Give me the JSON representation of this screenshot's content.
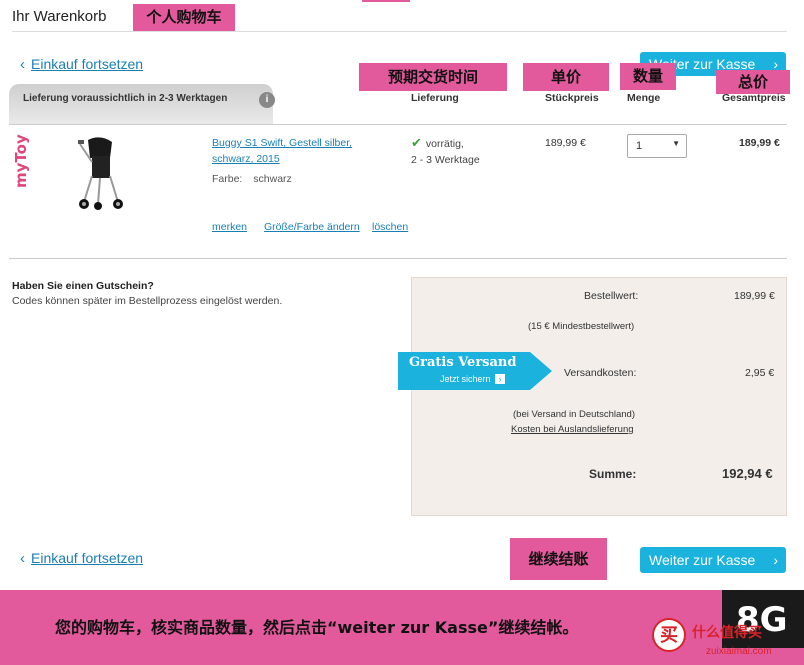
{
  "header": {
    "title": "Ihr Warenkorb",
    "title_tag": "个人购物车"
  },
  "continue_shopping": "Einkauf fortsetzen",
  "checkout_button": "Weiter zur Kasse",
  "delivery_tab": {
    "text": "Lieferung voraussichtlich in 2-3 Werktagen",
    "info_icon": "i"
  },
  "columns": {
    "delivery": "Lieferung",
    "unit_price": "Stückpreis",
    "quantity": "Menge",
    "total_price": "Gesamtpreis"
  },
  "column_tags": {
    "delivery": "预期交货时间",
    "unit_price": "单价",
    "quantity": "数量",
    "total_price": "总价"
  },
  "item": {
    "brand_logo": "myToys",
    "name_line1": "Buggy S1 Swift, Gestell silber,",
    "name_line2": "schwarz, 2015",
    "color_label": "Farbe:",
    "color_value": "schwarz",
    "availability": "vorrätig,",
    "delivery_time": "2 - 3 Werktage",
    "unit_price": "189,99 €",
    "quantity": "1",
    "total_price": "189,99 €",
    "actions": [
      "merken",
      "Größe/Farbe ändern",
      "löschen"
    ]
  },
  "voucher": {
    "title": "Haben Sie einen Gutschein?",
    "text": "Codes können später im Bestellprozess eingelöst werden."
  },
  "summary": {
    "order_value_label": "Bestellwert:",
    "order_value": "189,99 €",
    "minimum_note": "(15 € Mindestbestellwert)",
    "shipping_label": "Versandkosten:",
    "shipping_value": "2,95 €",
    "shipping_note": "(bei Versand in Deutschland)",
    "abroad_link": "Kosten bei Auslandslieferung",
    "sum_label": "Summe:",
    "sum_value": "192,94 €"
  },
  "free_shipping_badge": {
    "title": "Gratis Versand",
    "subtitle": "Jetzt sichern"
  },
  "checkout_tag": "继续结账",
  "bottom_banner": {
    "text": "您的购物车，核实商品数量，然后点击“weiter zur Kasse”继续结帐。",
    "logo_text": "8G",
    "watermark": "什么值得买",
    "watermark_url": "zuixiaimai.com",
    "watermark_char": "买"
  },
  "colors": {
    "accent_pink": "#e35a9c",
    "teal": "#1bb3de",
    "summary_bg": "#f3eeea",
    "check_green": "#3aa43a"
  }
}
